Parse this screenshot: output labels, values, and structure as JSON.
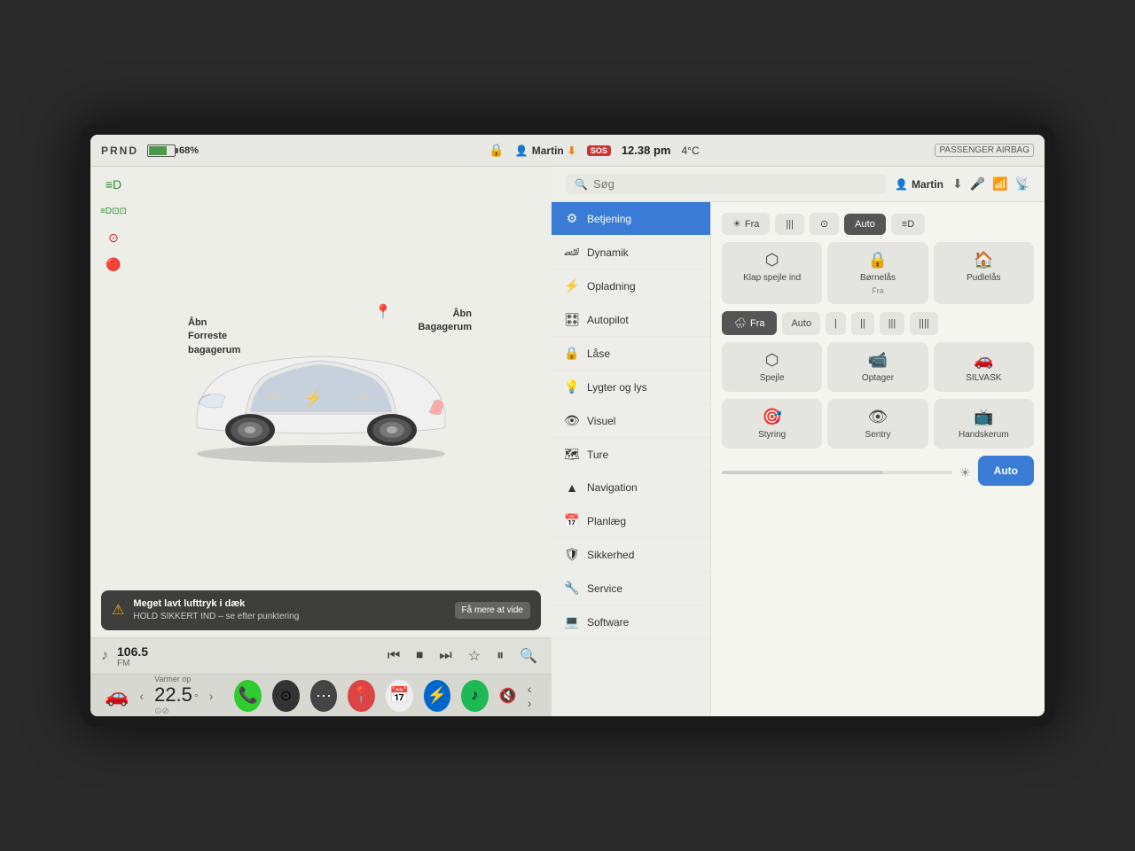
{
  "statusBar": {
    "prnd": "PRND",
    "battery": "68%",
    "user": "Martin",
    "time": "12.38 pm",
    "temp": "4°C",
    "passenger": "PASSENGER AIRBAG"
  },
  "leftPanel": {
    "openFront": "Åbn\nForreste\nbagagerum",
    "openTrunk": "Åbn\nBagagerum",
    "alert": {
      "title": "Meget lavt lufttryk i dæk",
      "subtitle": "HOLD SIKKERT IND – se efter punktering",
      "btn": "Få mere at vide"
    },
    "media": {
      "freq": "106.5",
      "type": "FM"
    }
  },
  "bottomBar": {
    "tempLabel": "Varmer op",
    "tempValue": "22.5"
  },
  "rightPanel": {
    "searchPlaceholder": "Søg",
    "user": "Martin",
    "settings": {
      "active": "Betjening",
      "items": [
        {
          "icon": "⚙️",
          "label": "Betjening"
        },
        {
          "icon": "🏎",
          "label": "Dynamik"
        },
        {
          "icon": "⚡",
          "label": "Opladning"
        },
        {
          "icon": "🎛",
          "label": "Autopilot"
        },
        {
          "icon": "🔒",
          "label": "Låse"
        },
        {
          "icon": "💡",
          "label": "Lygter og lys"
        },
        {
          "icon": "👁",
          "label": "Visuel"
        },
        {
          "icon": "🗺",
          "label": "Ture"
        },
        {
          "icon": "▲",
          "label": "Navigation"
        },
        {
          "icon": "📅",
          "label": "Planlæg"
        },
        {
          "icon": "🛡",
          "label": "Sikkerhed"
        },
        {
          "icon": "🔧",
          "label": "Service"
        },
        {
          "icon": "💻",
          "label": "Software"
        }
      ]
    },
    "controls": {
      "lightBtns": [
        "Fra",
        "|||",
        "🌞",
        "Auto",
        "⬜"
      ],
      "mirrorBtns": [
        "Klap spejle ind",
        "Børnelås\nFra",
        "Pudlelås"
      ],
      "wiperLabel": "Fra",
      "wiperSpeeds": [
        "Auto",
        "|",
        "||",
        "|||",
        "||||"
      ],
      "cameraBtns": [
        "Spejle",
        "Optager",
        "SILVASK"
      ],
      "steeringBtns": [
        "Styring",
        "Sentry",
        "Handskerum"
      ]
    }
  }
}
